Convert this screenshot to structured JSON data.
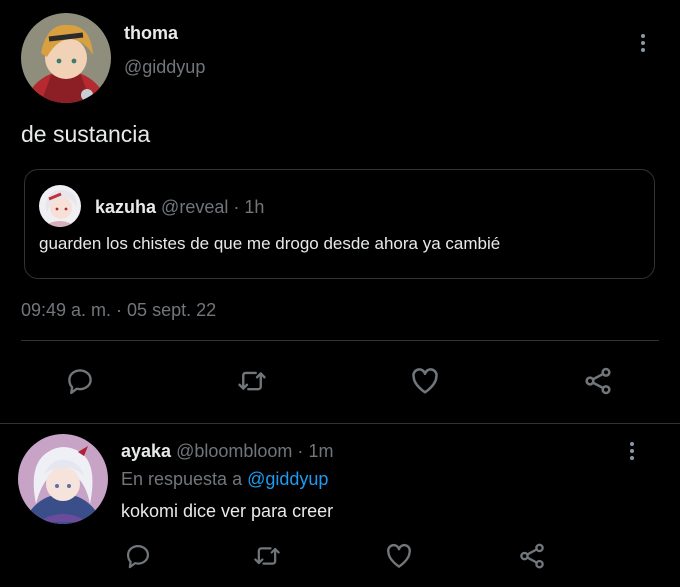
{
  "main_tweet": {
    "display_name": "thoma",
    "handle": "@giddyup",
    "text": "de sustancia",
    "timestamp": "09:49 a. m. · 05 sept. 22",
    "quoted": {
      "display_name": "kazuha",
      "handle": "@reveal",
      "separator": "·",
      "time": "1h",
      "text": "guarden los chistes de que me drogo desde ahora ya cambié"
    },
    "actions": [
      "reply-icon",
      "retweet-icon",
      "like-icon",
      "share-icon"
    ]
  },
  "reply": {
    "display_name": "ayaka",
    "handle": "@bloombloom",
    "separator": "·",
    "time": "1m",
    "reply_to_prefix": "En respuesta a",
    "reply_to_handle": "@giddyup",
    "text": "kokomi dice ver para creer",
    "actions": [
      "reply-icon",
      "retweet-icon",
      "like-icon",
      "share-icon"
    ]
  },
  "colors": {
    "background": "#000000",
    "text": "#e7e9ea",
    "muted": "#71767b",
    "link": "#1d9bf0",
    "border": "#2f3336"
  }
}
